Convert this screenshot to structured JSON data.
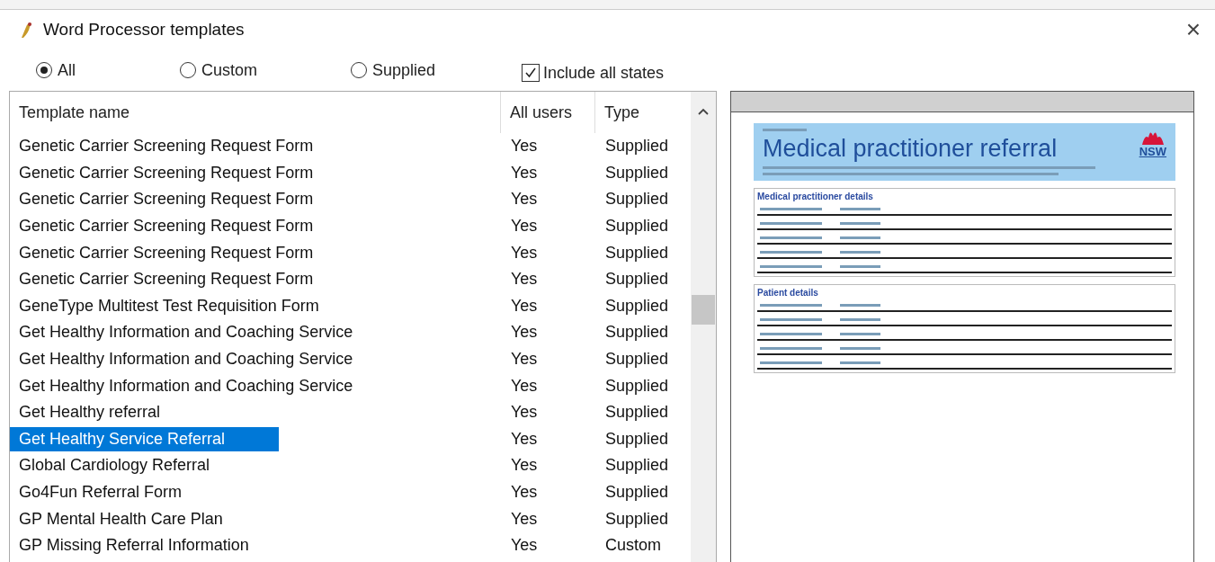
{
  "window": {
    "title": "Word Processor templates",
    "close": "×"
  },
  "filters": [
    {
      "label": "All",
      "selected": true
    },
    {
      "label": "Custom",
      "selected": false
    },
    {
      "label": "Supplied",
      "selected": false
    }
  ],
  "include_all_states": {
    "label": "Include all states",
    "checked": true
  },
  "table": {
    "columns": [
      "Template name",
      "All users",
      "Type"
    ],
    "rows": [
      {
        "name": "Genetic Carrier Screening Request Form",
        "all_users": "Yes",
        "type": "Supplied",
        "selected": false
      },
      {
        "name": "Genetic Carrier Screening Request Form",
        "all_users": "Yes",
        "type": "Supplied",
        "selected": false
      },
      {
        "name": "Genetic Carrier Screening Request Form",
        "all_users": "Yes",
        "type": "Supplied",
        "selected": false
      },
      {
        "name": "Genetic Carrier Screening Request Form",
        "all_users": "Yes",
        "type": "Supplied",
        "selected": false
      },
      {
        "name": "Genetic Carrier Screening Request Form",
        "all_users": "Yes",
        "type": "Supplied",
        "selected": false
      },
      {
        "name": "Genetic Carrier Screening Request Form",
        "all_users": "Yes",
        "type": "Supplied",
        "selected": false
      },
      {
        "name": "GeneType Multitest Test Requisition Form",
        "all_users": "Yes",
        "type": "Supplied",
        "selected": false
      },
      {
        "name": "Get Healthy Information and Coaching Service",
        "all_users": "Yes",
        "type": "Supplied",
        "selected": false
      },
      {
        "name": "Get Healthy Information and Coaching Service",
        "all_users": "Yes",
        "type": "Supplied",
        "selected": false
      },
      {
        "name": "Get Healthy Information and Coaching Service",
        "all_users": "Yes",
        "type": "Supplied",
        "selected": false
      },
      {
        "name": "Get Healthy referral",
        "all_users": "Yes",
        "type": "Supplied",
        "selected": false
      },
      {
        "name": "Get Healthy Service Referral",
        "all_users": "Yes",
        "type": "Supplied",
        "selected": true
      },
      {
        "name": "Global Cardiology Referral",
        "all_users": "Yes",
        "type": "Supplied",
        "selected": false
      },
      {
        "name": "Go4Fun Referral Form",
        "all_users": "Yes",
        "type": "Supplied",
        "selected": false
      },
      {
        "name": "GP Mental Health Care Plan",
        "all_users": "Yes",
        "type": "Supplied",
        "selected": false
      },
      {
        "name": "GP Missing Referral Information",
        "all_users": "Yes",
        "type": "Custom",
        "selected": false
      }
    ]
  },
  "preview": {
    "title": "Medical practitioner referral",
    "logo": "NSW",
    "sections": [
      "Medical practitioner details",
      "Patient details"
    ]
  }
}
